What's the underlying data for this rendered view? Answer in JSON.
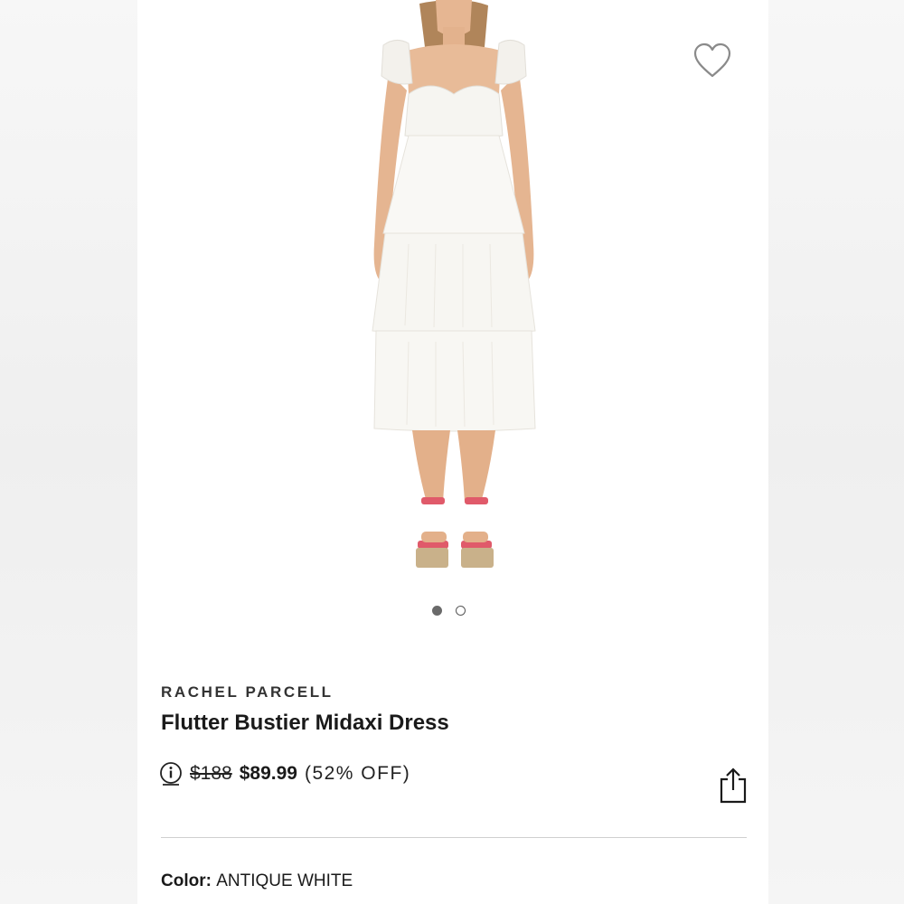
{
  "product": {
    "brand": "RACHEL PARCELL",
    "title": "Flutter Bustier Midaxi Dress",
    "original_price": "$188",
    "sale_price": "$89.99",
    "discount": "(52% OFF)",
    "color_label": "Color:",
    "color_value": "ANTIQUE WHITE"
  },
  "carousel": {
    "total_images": 2,
    "active_index": 0
  },
  "icons": {
    "favorite": "heart-outline-icon",
    "info": "info-circle-icon",
    "share": "share-icon"
  },
  "colors": {
    "dress": "#f8f7f3",
    "sandal_strap": "#e05a6a",
    "sandal_sole": "#c9b18a",
    "skin": "#e8b996",
    "hair": "#a97a4f"
  }
}
